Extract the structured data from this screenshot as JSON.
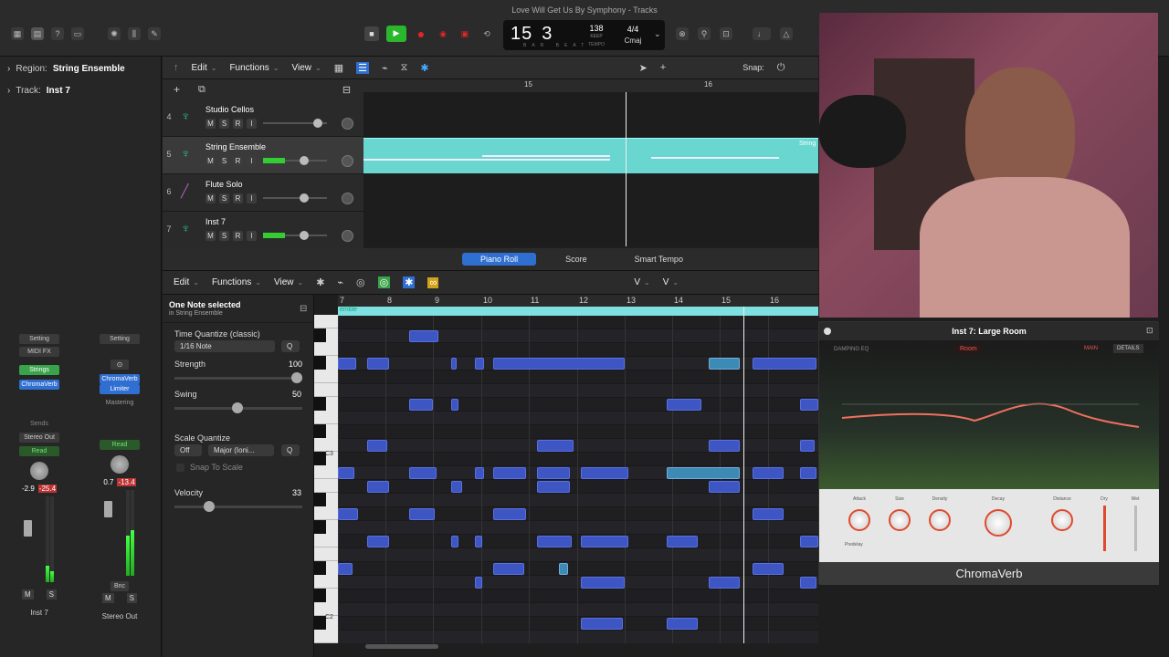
{
  "window": {
    "title": "Love Will Get Us By Symphony - Tracks"
  },
  "lcd": {
    "bar": "15",
    "beat": "3",
    "sub": "BAR BEAT",
    "tempo": "138",
    "tempo_mode": "KEEP",
    "tempo_label": "TEMPO",
    "signature": "4/4",
    "key": "Cmaj"
  },
  "inspector": {
    "region_label": "Region:",
    "region_value": "String Ensemble",
    "track_label": "Track:",
    "track_value": "Inst 7",
    "strip1": {
      "setting": "Setting",
      "midi_fx": "MIDI FX",
      "instrument": "Strings",
      "effect": "ChromaVerb",
      "sends": "Sends",
      "output": "Stereo Out",
      "automation": "Read",
      "volume": "-2.9",
      "peak": "-25.4",
      "mute": "M",
      "solo": "S",
      "name": "Inst 7"
    },
    "strip2": {
      "setting": "Setting",
      "effect1": "ChromaVerb",
      "effect2": "Limiter",
      "mastering": "Mastering",
      "automation": "Read",
      "volume": "0.7",
      "peak": "-13.4",
      "bounce": "Bnc",
      "mute": "M",
      "solo": "S",
      "name": "Stereo Out"
    }
  },
  "tracks_toolbar": {
    "edit": "Edit",
    "functions": "Functions",
    "view": "View",
    "snap": "Snap:"
  },
  "ruler": {
    "bar15": "15",
    "bar16": "16"
  },
  "tracks": [
    {
      "num": "4",
      "name": "Studio Cellos",
      "m": "M",
      "s": "S",
      "r": "R",
      "i": "I"
    },
    {
      "num": "5",
      "name": "String Ensemble",
      "m": "M",
      "s": "S",
      "r": "R",
      "i": "I"
    },
    {
      "num": "6",
      "name": "Flute Solo",
      "m": "M",
      "s": "S",
      "r": "R",
      "i": "I"
    },
    {
      "num": "7",
      "name": "Inst 7",
      "m": "M",
      "s": "S",
      "r": "R",
      "i": "I"
    }
  ],
  "region_label": "String",
  "editor_tabs": {
    "piano_roll": "Piano Roll",
    "score": "Score",
    "smart_tempo": "Smart Tempo"
  },
  "pr_toolbar": {
    "edit": "Edit",
    "functions": "Functions",
    "view": "View",
    "v1": "V",
    "v2": "V"
  },
  "pr_left": {
    "status": "One Note selected",
    "status_sub": "in String Ensemble",
    "tq_label": "Time Quantize (classic)",
    "tq_value": "1/16 Note",
    "q": "Q",
    "strength_label": "Strength",
    "strength_value": "100",
    "swing_label": "Swing",
    "swing_value": "50",
    "sq_label": "Scale Quantize",
    "sq_off": "Off",
    "sq_scale": "Major (Ioni...",
    "sq_q": "Q",
    "snap_label": "Snap To Scale",
    "velocity_label": "Velocity",
    "velocity_value": "33"
  },
  "pr_ruler": [
    "7",
    "8",
    "9",
    "10",
    "11",
    "12",
    "13",
    "14",
    "15",
    "16"
  ],
  "pr_region": "emble",
  "keys": {
    "c3": "C3",
    "c2": "C2"
  },
  "plugin": {
    "title": "Inst 7: Large Room",
    "damping": "DAMPING EQ",
    "room": "Room",
    "main": "MAIN",
    "details": "DETAILS",
    "attack": "Attack",
    "size": "Size",
    "density": "Density",
    "decay": "Decay",
    "distance": "Distance",
    "dry": "Dry",
    "wet": "Wet",
    "predelay": "Predelay",
    "name": "ChromaVerb"
  },
  "colors": {
    "accent": "#2f6fd1",
    "note": "#3d56c4",
    "note_selected": "#3c8bb5",
    "region": "#6ad6d0",
    "play": "#2bb72b",
    "record": "#e02626"
  }
}
